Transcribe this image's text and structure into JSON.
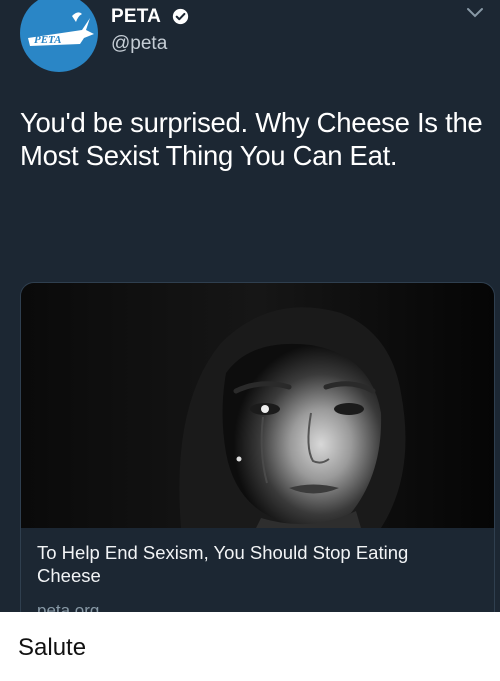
{
  "tweet": {
    "display_name": "PETA",
    "handle": "@peta",
    "text": "You'd be surprised. Why Cheese Is the Most Sexist Thing You Can Eat.",
    "avatar_logo_text": "PETA",
    "card": {
      "title": "To Help End Sexism, You Should Stop Eating Cheese",
      "domain": "peta.org"
    }
  },
  "caption": "Salute",
  "icons": [
    "verified-badge-icon",
    "chevron-down-icon"
  ],
  "colors": {
    "tweet_bg": "#1c2733",
    "avatar_bg": "#2a86c6",
    "text": "#ffffff",
    "muted": "#8899a6"
  }
}
